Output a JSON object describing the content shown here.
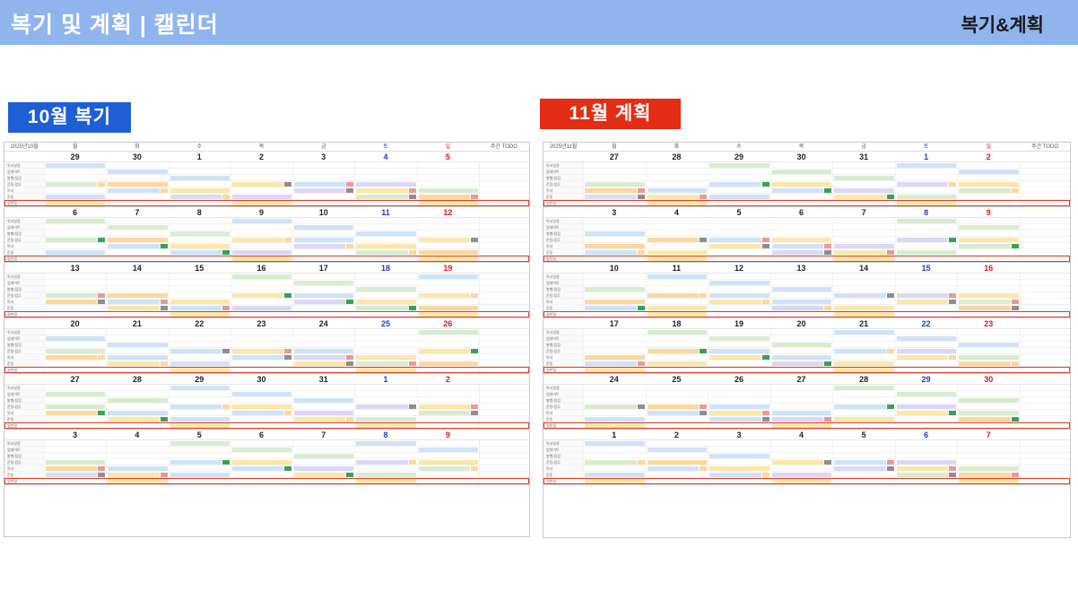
{
  "header": {
    "title": "복기 및 계획 | 캘린더",
    "brand": "복기&계획"
  },
  "oct": {
    "badge": "10월 복기",
    "label": "2025년10월",
    "todo": "주간 TODO",
    "weekdays": [
      "월",
      "화",
      "수",
      "목",
      "금",
      "토",
      "일"
    ],
    "categories": [
      "독서일정",
      "업데이트",
      "발행/점검",
      "운동/업무",
      "독서",
      "운동",
      "일반일"
    ],
    "weeks": [
      [
        "29",
        "30",
        "1",
        "2",
        "3",
        "4",
        "5"
      ],
      [
        "6",
        "7",
        "8",
        "9",
        "10",
        "11",
        "12"
      ],
      [
        "13",
        "14",
        "15",
        "16",
        "17",
        "18",
        "19"
      ],
      [
        "20",
        "21",
        "22",
        "23",
        "24",
        "25",
        "26"
      ],
      [
        "27",
        "28",
        "29",
        "30",
        "31",
        "1",
        "2"
      ],
      [
        "3",
        "4",
        "5",
        "6",
        "7",
        "8",
        "9"
      ]
    ]
  },
  "nov": {
    "badge": "11월 계획",
    "label": "2025년11월",
    "todo": "주간 TODO",
    "weekdays": [
      "월",
      "화",
      "수",
      "목",
      "금",
      "토",
      "일"
    ],
    "categories": [
      "독서일정",
      "업데이트",
      "발행/점검",
      "운동/업무",
      "독서",
      "운동",
      "일반일"
    ],
    "weeks": [
      [
        "27",
        "28",
        "29",
        "30",
        "31",
        "1",
        "2"
      ],
      [
        "3",
        "4",
        "5",
        "6",
        "7",
        "8",
        "9"
      ],
      [
        "10",
        "11",
        "12",
        "13",
        "14",
        "15",
        "16"
      ],
      [
        "17",
        "18",
        "19",
        "20",
        "21",
        "22",
        "23"
      ],
      [
        "24",
        "25",
        "26",
        "27",
        "28",
        "29",
        "30"
      ],
      [
        "1",
        "2",
        "3",
        "4",
        "5",
        "6",
        "7"
      ]
    ]
  }
}
